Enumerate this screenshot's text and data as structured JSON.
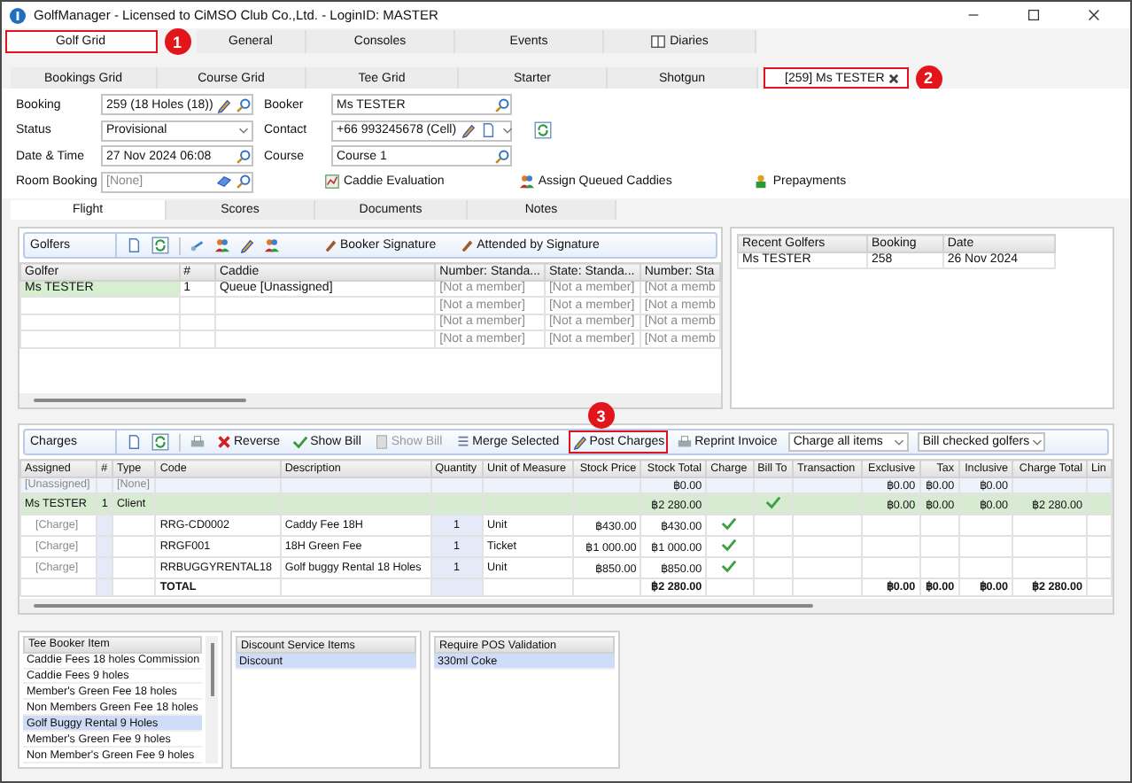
{
  "window": {
    "title": "GolfManager - Licensed to CiMSO Club Co.,Ltd. - LoginID: MASTER"
  },
  "main_tabs": [
    {
      "label": "Golf Grid",
      "selected": true,
      "highlighted": true,
      "callout": "1",
      "kind": "plain"
    },
    {
      "label": "General",
      "selected": false,
      "highlighted": false,
      "kind": "plain"
    },
    {
      "label": "Consoles",
      "selected": false,
      "highlighted": false,
      "kind": "plain"
    },
    {
      "label": "Events",
      "selected": false,
      "highlighted": false,
      "kind": "plain"
    },
    {
      "label": "Diaries",
      "selected": false,
      "highlighted": false,
      "kind": "with_icon"
    }
  ],
  "sub_tabs": [
    {
      "label": "Bookings Grid",
      "selected": false,
      "closable": false,
      "highlighted": false
    },
    {
      "label": "Course Grid",
      "selected": false,
      "closable": false,
      "highlighted": false
    },
    {
      "label": "Tee Grid",
      "selected": false,
      "closable": false,
      "highlighted": false
    },
    {
      "label": "Starter",
      "selected": false,
      "closable": false,
      "highlighted": false
    },
    {
      "label": "Shotgun",
      "selected": false,
      "closable": false,
      "highlighted": false
    },
    {
      "label": "[259] Ms TESTER",
      "selected": true,
      "closable": true,
      "highlighted": true,
      "callout": "2"
    }
  ],
  "form": {
    "left": [
      {
        "label": "Booking",
        "value": "259 (18 Holes (18))",
        "kind": "editable"
      },
      {
        "label": "Status",
        "value": "Provisional",
        "kind": "dropdown"
      },
      {
        "label": "Date & Time",
        "value": "27 Nov 2024 06:08",
        "kind": "lookup"
      },
      {
        "label": "Room Booking",
        "placeholder": "[None]",
        "kind": "clearable"
      }
    ],
    "right": [
      {
        "label": "Booker",
        "value": "Ms TESTER",
        "kind": "lookup"
      },
      {
        "label": "Contact",
        "value": "+66 993245678 (Cell)",
        "kind": "contact"
      },
      {
        "label": "Course",
        "value": "Course 1",
        "kind": "lookup"
      }
    ],
    "actions": [
      {
        "label": "Caddie Evaluation"
      },
      {
        "label": "Assign Queued Caddies"
      },
      {
        "label": "Prepayments"
      }
    ]
  },
  "detail_tabs": [
    {
      "label": "Flight",
      "selected": true
    },
    {
      "label": "Scores",
      "selected": false
    },
    {
      "label": "Documents",
      "selected": false
    },
    {
      "label": "Notes",
      "selected": false
    }
  ],
  "golfers": {
    "title": "Golfers",
    "buttons": [
      {
        "label": "Booker Signature"
      },
      {
        "label": "Attended by Signature"
      }
    ],
    "columns": [
      "Golfer",
      "#",
      "Caddie",
      "Number: Standa...",
      "State: Standa...",
      "Number: Sta"
    ],
    "rows": [
      {
        "selected": true,
        "cells": [
          "Ms TESTER",
          "1",
          "Queue [Unassigned]",
          "[Not a member]",
          "[Not a member]",
          "[Not a memb"
        ]
      },
      {
        "selected": false,
        "cells": [
          "",
          "",
          "",
          "[Not a member]",
          "[Not a member]",
          "[Not a memb"
        ]
      },
      {
        "selected": false,
        "cells": [
          "",
          "",
          "",
          "[Not a member]",
          "[Not a member]",
          "[Not a memb"
        ]
      },
      {
        "selected": false,
        "cells": [
          "",
          "",
          "",
          "[Not a member]",
          "[Not a member]",
          "[Not a memb"
        ]
      }
    ]
  },
  "recent_golfers": {
    "columns": [
      "Recent Golfers",
      "Booking",
      "Date"
    ],
    "rows": [
      [
        "Ms TESTER",
        "258",
        "26 Nov 2024"
      ]
    ]
  },
  "charges": {
    "title": "Charges",
    "buttons": [
      {
        "label": "Reverse",
        "disabled": false,
        "highlighted": false
      },
      {
        "label": "Show Bill",
        "disabled": false,
        "highlighted": false
      },
      {
        "label": "Show Bill",
        "disabled": true,
        "highlighted": false
      },
      {
        "label": "Merge Selected",
        "disabled": false,
        "highlighted": false
      },
      {
        "label": "Post Charges",
        "disabled": false,
        "highlighted": true,
        "callout": "3"
      },
      {
        "label": "Reprint Invoice",
        "disabled": false,
        "highlighted": false
      }
    ],
    "selects": [
      {
        "value": "Charge all items"
      },
      {
        "value": "Bill checked golfers"
      }
    ],
    "columns": [
      "Assigned",
      "#",
      "Type",
      "Code",
      "Description",
      "Quantity",
      "Unit of Measure",
      "Stock Price",
      "Stock Total",
      "Charge",
      "Bill To",
      "Transaction",
      "Exclusive",
      "Tax",
      "Inclusive",
      "Charge Total",
      "Lin"
    ],
    "rows": [
      {
        "kind": "unassigned",
        "assigned": "[Unassigned]",
        "type": "[None]",
        "stock_total": "฿0.00",
        "charge": false,
        "bill_to": false,
        "exclusive": "฿0.00",
        "tax": "฿0.00",
        "inclusive": "฿0.00"
      },
      {
        "kind": "client",
        "assigned": "Ms TESTER",
        "number": "1",
        "type": "Client",
        "stock_total": "฿2 280.00",
        "charge": false,
        "bill_to": true,
        "exclusive": "฿0.00",
        "tax": "฿0.00",
        "inclusive": "฿0.00",
        "charge_total": "฿2 280.00"
      },
      {
        "kind": "charge",
        "assigned": "[Charge]",
        "code": "RRG-CD0002",
        "description": "Caddy Fee 18H",
        "quantity": "1",
        "unit": "Unit",
        "stock_price": "฿430.00",
        "stock_total": "฿430.00",
        "charge": true,
        "bill_to": false
      },
      {
        "kind": "charge",
        "assigned": "[Charge]",
        "code": "RRGF001",
        "description": "18H Green Fee",
        "quantity": "1",
        "unit": "Ticket",
        "stock_price": "฿1 000.00",
        "stock_total": "฿1 000.00",
        "charge": true,
        "bill_to": false
      },
      {
        "kind": "charge",
        "assigned": "[Charge]",
        "code": "RRBUGGYRENTAL18",
        "description": "Golf buggy Rental 18 Holes",
        "quantity": "1",
        "unit": "Unit",
        "stock_price": "฿850.00",
        "stock_total": "฿850.00",
        "charge": true,
        "bill_to": false
      },
      {
        "kind": "total",
        "code": "TOTAL",
        "stock_total": "฿2 280.00",
        "charge": false,
        "bill_to": false,
        "exclusive": "฿0.00",
        "tax": "฿0.00",
        "inclusive": "฿0.00",
        "charge_total": "฿2 280.00"
      }
    ]
  },
  "item_lists": [
    {
      "title": "Tee Booker Item",
      "items": [
        {
          "label": "Caddie Fees 18 holes Commission",
          "selected": false
        },
        {
          "label": "Caddie Fees 9 holes",
          "selected": false
        },
        {
          "label": "Member's Green Fee 18 holes",
          "selected": false
        },
        {
          "label": "Non Members Green Fee 18 holes",
          "selected": false
        },
        {
          "label": "Golf Buggy Rental 9 Holes",
          "selected": true
        },
        {
          "label": "Member's Green Fee 9 holes",
          "selected": false
        },
        {
          "label": "Non Member's Green Fee 9 holes",
          "selected": false
        }
      ]
    },
    {
      "title": "Discount Service Items",
      "items": [
        {
          "label": "Discount",
          "selected": true
        }
      ]
    },
    {
      "title": "Require POS Validation",
      "items": [
        {
          "label": "330ml Coke",
          "selected": true
        }
      ]
    }
  ]
}
